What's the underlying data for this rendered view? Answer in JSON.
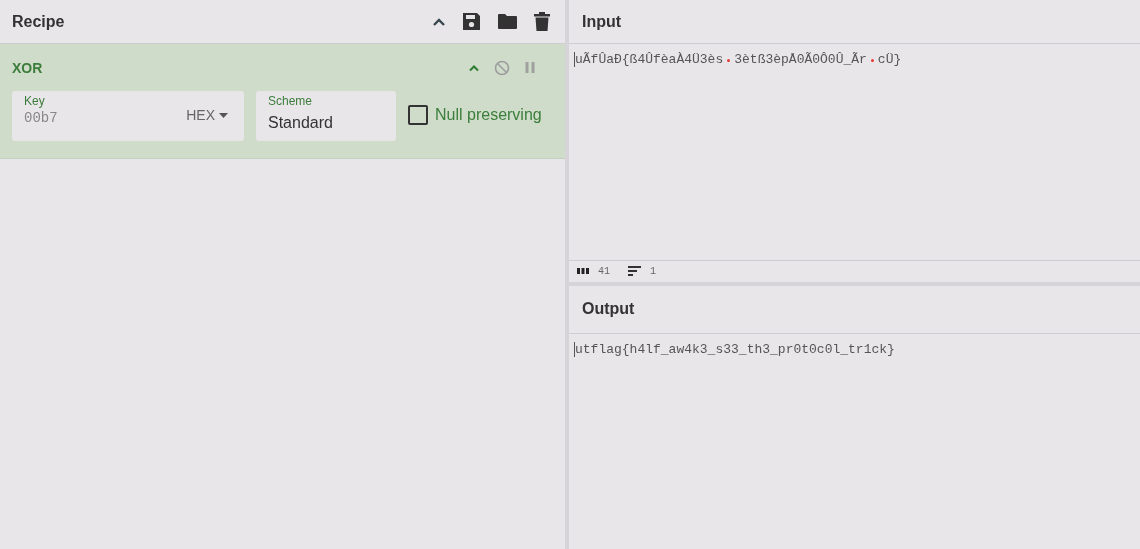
{
  "recipe": {
    "title": "Recipe"
  },
  "operation": {
    "name": "XOR",
    "disabled": false,
    "paused": false,
    "key": {
      "label": "Key",
      "value": "00b7",
      "format": "HEX"
    },
    "scheme": {
      "label": "Scheme",
      "value": "Standard"
    },
    "null_preserving": {
      "label": "Null preserving",
      "checked": false
    }
  },
  "input": {
    "title": "Input",
    "segments": [
      "uÃfÛaÐ{ß4ÛfèaÀ4Ü3ès",
      "3ètß3èpÅ0Ã0Ô0Û_Ãr",
      "cÜ}"
    ],
    "length": "41",
    "lines": "1"
  },
  "output": {
    "title": "Output",
    "text": "utflag{h4lf_aw4k3_s33_th3_pr0t0c0l_tr1ck}"
  }
}
